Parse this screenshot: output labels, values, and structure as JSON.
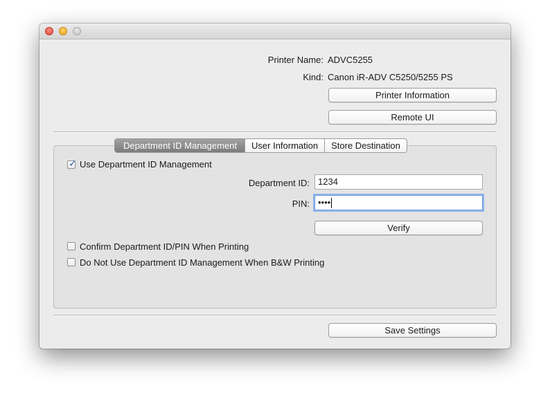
{
  "info": {
    "printer_name_label": "Printer Name:",
    "printer_name_value": "ADVC5255",
    "kind_label": "Kind:",
    "kind_value": "Canon iR-ADV C5250/5255 PS"
  },
  "buttons": {
    "printer_information": "Printer Information",
    "remote_ui": "Remote UI",
    "verify": "Verify",
    "save_settings": "Save Settings"
  },
  "tabs": [
    {
      "label": "Department ID Management",
      "selected": true
    },
    {
      "label": "User Information",
      "selected": false
    },
    {
      "label": "Store Destination",
      "selected": false
    }
  ],
  "department": {
    "use_dept_id_label": "Use Department ID Management",
    "use_dept_id_checked": true,
    "dept_id_label": "Department ID:",
    "dept_id_value": "1234",
    "pin_label": "PIN:",
    "pin_value": "••••",
    "confirm_label": "Confirm Department ID/PIN When Printing",
    "confirm_checked": false,
    "no_bw_label": "Do Not Use Department ID Management When B&W Printing",
    "no_bw_checked": false
  },
  "colors": {
    "window_bg": "#ececec",
    "focus_ring": "#8fb6ea",
    "checkmark": "#2a5ea8"
  }
}
